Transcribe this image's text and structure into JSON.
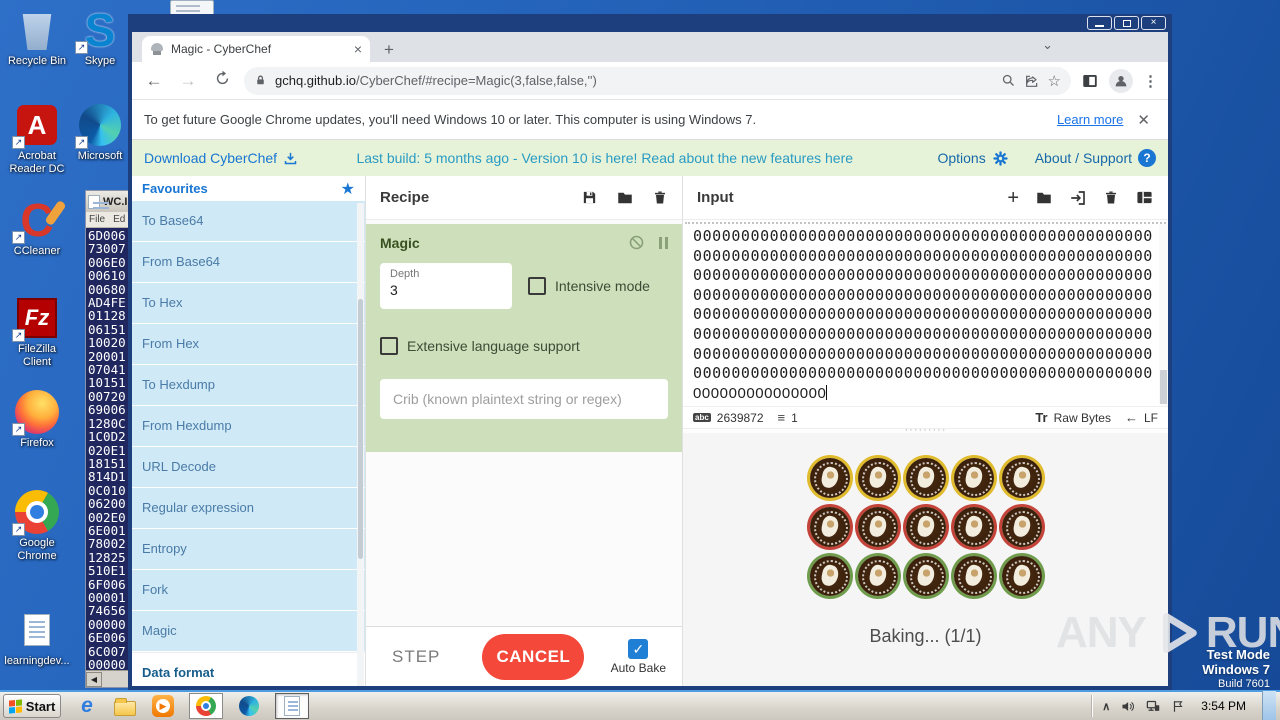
{
  "desktop": {
    "icons": [
      {
        "label": "Recycle Bin"
      },
      {
        "label": "Skype"
      },
      {
        "label": "Acrobat Reader DC"
      },
      {
        "label": "Microsoft"
      },
      {
        "label": "CCleaner"
      },
      {
        "label": "FileZilla Client"
      },
      {
        "label": "Firefox"
      },
      {
        "label": "Google Chrome"
      },
      {
        "label": "learningdev..."
      }
    ],
    "watermark": {
      "any": "ANY",
      "run": "RUN"
    },
    "test_mode": {
      "line1": "Test Mode",
      "line2": "Windows 7",
      "line3": "Build 7601"
    }
  },
  "hex_window": {
    "title": "WC.I",
    "menu": [
      "File",
      "Ed"
    ],
    "lines": [
      "6D006",
      "73007",
      "006E0",
      "00610",
      "00680",
      "AD4FE",
      "01128",
      "06151",
      "10020",
      "20001",
      "07041",
      "10151",
      "00720",
      "69006",
      "1280C",
      "1C0D2",
      "020E1",
      "18151",
      "814D1",
      "0C010",
      "06200",
      "002E0",
      "6E001",
      "78002",
      "12825",
      "510E1",
      "6F006",
      "00001",
      "74656",
      "00000",
      "6E006",
      "6C007",
      "00000"
    ]
  },
  "browser": {
    "tab_title": "Magic - CyberChef",
    "url_host": "gchq.github.io",
    "url_path": "/CyberChef/#recipe=Magic(3,false,false,'')",
    "infobar": {
      "message": "To get future Google Chrome updates, you'll need Windows 10 or later. This computer is using Windows 7.",
      "learn_more": "Learn more"
    }
  },
  "cyberchef": {
    "banner": {
      "download": "Download CyberChef",
      "build_info": "Last build: 5 months ago - Version 10 is here! Read about the new features here",
      "options": "Options",
      "about": "About / Support"
    },
    "operations": {
      "header": "Favourites",
      "items": [
        "To Base64",
        "From Base64",
        "To Hex",
        "From Hex",
        "To Hexdump",
        "From Hexdump",
        "URL Decode",
        "Regular expression",
        "Entropy",
        "Fork",
        "Magic"
      ],
      "category": "Data format"
    },
    "recipe": {
      "title": "Recipe",
      "op_name": "Magic",
      "depth_label": "Depth",
      "depth_value": "3",
      "intensive_label": "Intensive mode",
      "extensive_label": "Extensive language support",
      "crib_placeholder": "Crib (known plaintext string or regex)",
      "step_label": "STEP",
      "cancel_label": "CANCEL",
      "autobake_label": "Auto Bake"
    },
    "input": {
      "title": "Input",
      "lines": [
        "000000000000000000000000000000000000000000000000",
        "000000000000000000000000000000000000000000000000",
        "000000000000000000000000000000000000000000000000",
        "000000000000000000000000000000000000000000000000",
        "000000000000000000000000000000000000000000000000",
        "000000000000000000000000000000000000000000000000",
        "000000000000000000000000000000000000000000000000",
        "000000000000000000000000000000000000000000000000"
      ],
      "last_line": "000000000000000",
      "char_count": "2639872",
      "line_count": "1",
      "encoding": "Raw Bytes",
      "eol": "LF"
    },
    "output": {
      "baking_text": "Baking... (1/1)",
      "cookie_rows": [
        {
          "ring": "#e0bb2e",
          "count": 5
        },
        {
          "ring": "#c4443a",
          "count": 5
        },
        {
          "ring": "#6f9c4d",
          "count": 5
        }
      ]
    }
  },
  "taskbar": {
    "start_label": "Start",
    "clock": "3:54 PM"
  },
  "colors": {
    "accent_blue": "#1976d2",
    "cancel_red": "#f4483a",
    "op_green": "#cde0bb",
    "fav_blue": "#cfe9f7"
  }
}
